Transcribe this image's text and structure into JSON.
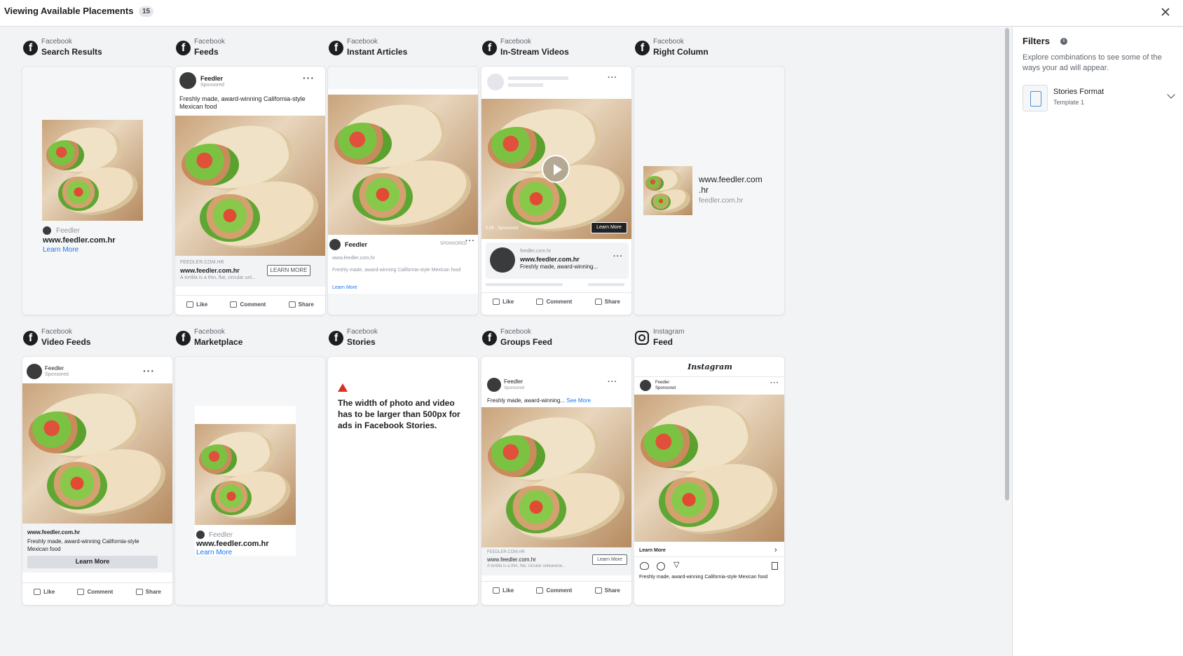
{
  "header": {
    "title": "Viewing Available Placements",
    "count": "15"
  },
  "common": {
    "page_name": "Feedler",
    "sponsored": "Sponsored",
    "url": "www.feedler.com.hr",
    "url_short": "feedler.com.hr",
    "url_caps": "FEEDLER.COM.HR",
    "learn_more": "Learn More",
    "learn_more_caps": "LEARN MORE",
    "sponsored_caps": "SPONSORED",
    "caption": "Freshly made, award-winning California-style Mexican food",
    "caption_short": "Freshly made, award-winning...",
    "caption_see": "Freshly made, award-winning...",
    "see_more": "See More",
    "tortilla": "A tortilla is a thin, flat, circular unl...",
    "tortilla2": "A tortilla is a thin, flat, circular unleavene...",
    "like": "Like",
    "comment": "Comment",
    "share": "Share",
    "right_url_a": "www.feedler.com",
    "right_url_b": ".hr",
    "video_time": "0:06 · Sponsored",
    "instagram_logo": "Instagram"
  },
  "placements": [
    {
      "platform": "Facebook",
      "name": "Search Results"
    },
    {
      "platform": "Facebook",
      "name": "Feeds"
    },
    {
      "platform": "Facebook",
      "name": "Instant Articles"
    },
    {
      "platform": "Facebook",
      "name": "In-Stream Videos"
    },
    {
      "platform": "Facebook",
      "name": "Right Column"
    },
    {
      "platform": "Facebook",
      "name": "Video Feeds"
    },
    {
      "platform": "Facebook",
      "name": "Marketplace"
    },
    {
      "platform": "Facebook",
      "name": "Stories"
    },
    {
      "platform": "Facebook",
      "name": "Groups Feed"
    },
    {
      "platform": "Instagram",
      "name": "Feed"
    }
  ],
  "stories_warning": "The width of photo and video has to be larger than 500px for ads in Facebook Stories.",
  "filters": {
    "title": "Filters",
    "description": "Explore combinations to see some of the ways your ad will appear.",
    "format_name": "Stories Format",
    "format_template": "Template 1"
  },
  "icons": [
    "facebook-icon",
    "instagram-icon",
    "close-icon",
    "info-icon",
    "chevron-down-icon",
    "warning-icon",
    "play-icon",
    "like-icon",
    "comment-icon",
    "share-icon",
    "more-icon"
  ]
}
